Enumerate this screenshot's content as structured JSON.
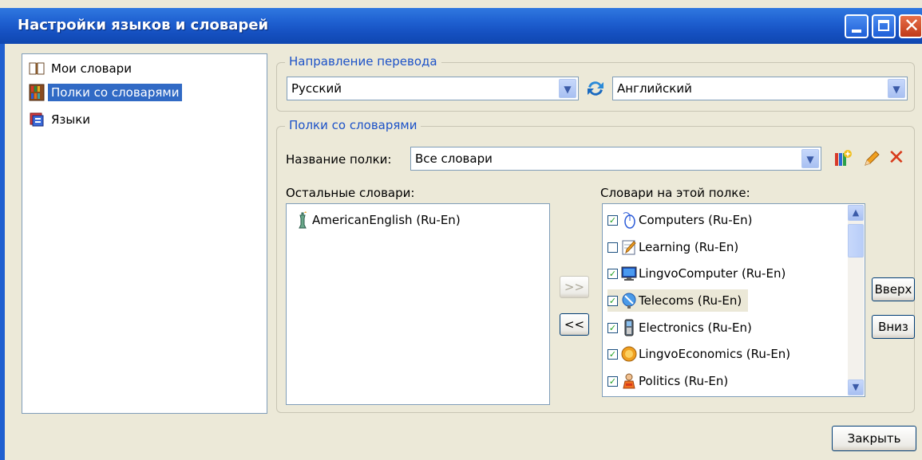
{
  "window": {
    "title": "Настройки языков и словарей"
  },
  "nav": {
    "items": [
      {
        "label": "Мои словари",
        "icon": "book-icon"
      },
      {
        "label": "Полки со словарями",
        "icon": "bookshelf-icon"
      },
      {
        "label": "Языки",
        "icon": "languages-icon"
      }
    ],
    "selected_index": 1
  },
  "direction": {
    "legend": "Направление перевода",
    "from": "Русский",
    "to": "Английский",
    "swap_icon": "swap-arrows-icon"
  },
  "shelves": {
    "legend": "Полки со словарями",
    "shelf_name_label": "Название полки:",
    "shelf_name": "Все словари",
    "other_label": "Остальные словари:",
    "on_shelf_label": "Словари на этой полке:",
    "other_dictionaries": [
      {
        "label": "AmericanEnglish (Ru-En)",
        "icon": "statue-of-liberty-icon"
      }
    ],
    "shelf_dictionaries": [
      {
        "label": "Computers (Ru-En)",
        "checked": true,
        "icon": "mouse-icon"
      },
      {
        "label": "Learning (Ru-En)",
        "checked": false,
        "icon": "notepad-pencil-icon"
      },
      {
        "label": "LingvoComputer (Ru-En)",
        "checked": true,
        "icon": "monitor-icon"
      },
      {
        "label": "Telecoms (Ru-En)",
        "checked": true,
        "icon": "satellite-dish-icon"
      },
      {
        "label": "Electronics (Ru-En)",
        "checked": true,
        "icon": "mobile-phone-icon"
      },
      {
        "label": "LingvoEconomics (Ru-En)",
        "checked": true,
        "icon": "coin-icon"
      },
      {
        "label": "Politics (Ru-En)",
        "checked": true,
        "icon": "speaker-podium-icon"
      }
    ],
    "highlighted_index": 3,
    "add_label": ">>",
    "remove_label": "<<",
    "up_label": "Вверх",
    "down_label": "Вниз"
  },
  "footer": {
    "close_label": "Закрыть"
  }
}
